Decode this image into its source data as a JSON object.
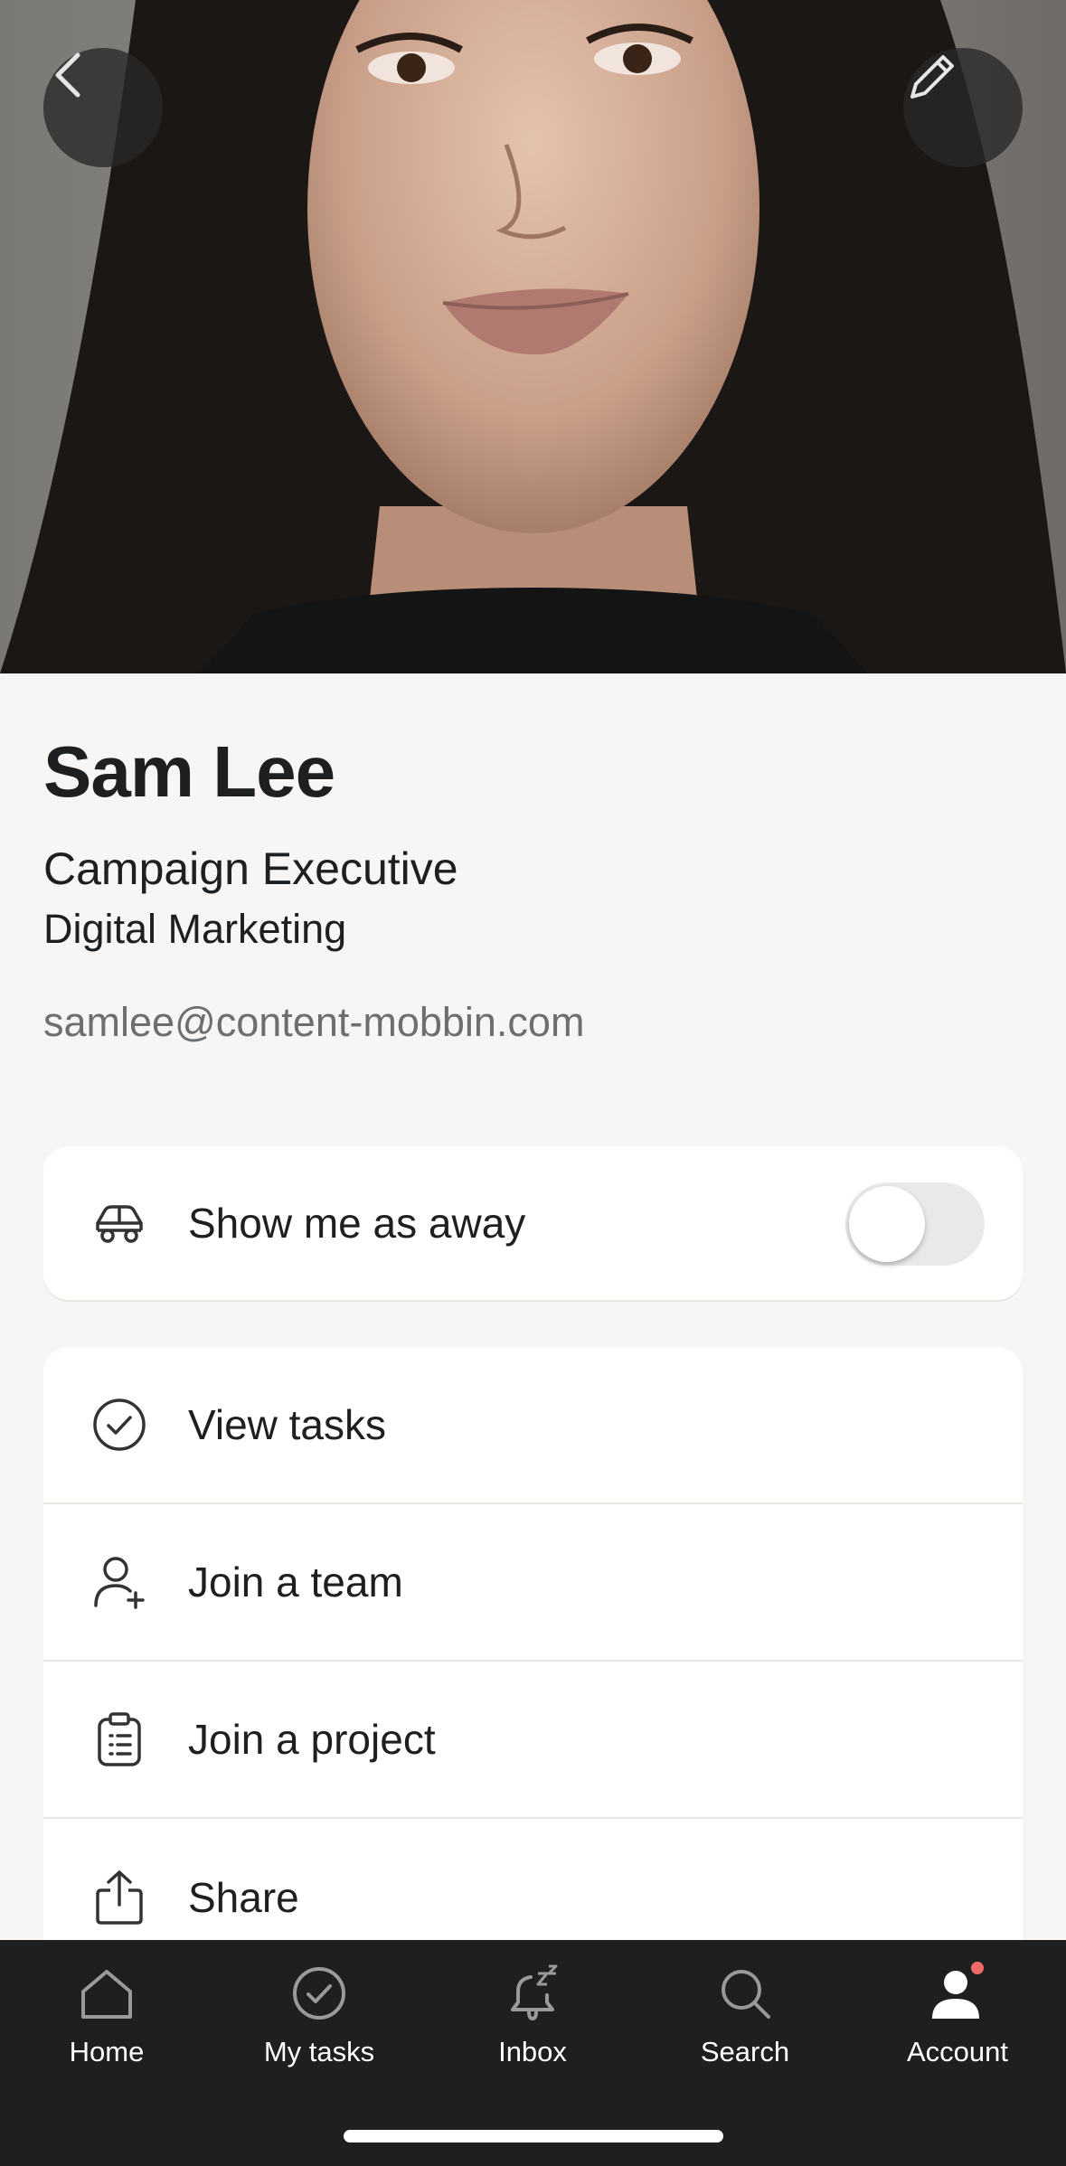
{
  "profile": {
    "name": "Sam Lee",
    "job_title": "Campaign Executive",
    "department": "Digital Marketing",
    "email": "samlee@content-mobbin.com"
  },
  "away": {
    "label": "Show me as away",
    "enabled": false,
    "icon": "car-icon"
  },
  "menu": [
    {
      "label": "View tasks",
      "icon": "check-circle-icon"
    },
    {
      "label": "Join a team",
      "icon": "add-person-icon"
    },
    {
      "label": "Join a project",
      "icon": "clipboard-icon"
    },
    {
      "label": "Share",
      "icon": "share-icon"
    }
  ],
  "tabs": [
    {
      "label": "Home",
      "icon": "home-icon"
    },
    {
      "label": "My tasks",
      "icon": "check-circle-icon"
    },
    {
      "label": "Inbox",
      "icon": "bell-snooze-icon"
    },
    {
      "label": "Search",
      "icon": "search-icon"
    },
    {
      "label": "Account",
      "icon": "account-icon",
      "active": true
    }
  ],
  "colors": {
    "background": "#f7f6f4",
    "tabbar": "#1e1f21",
    "notification_dot": "#f06a6a"
  }
}
